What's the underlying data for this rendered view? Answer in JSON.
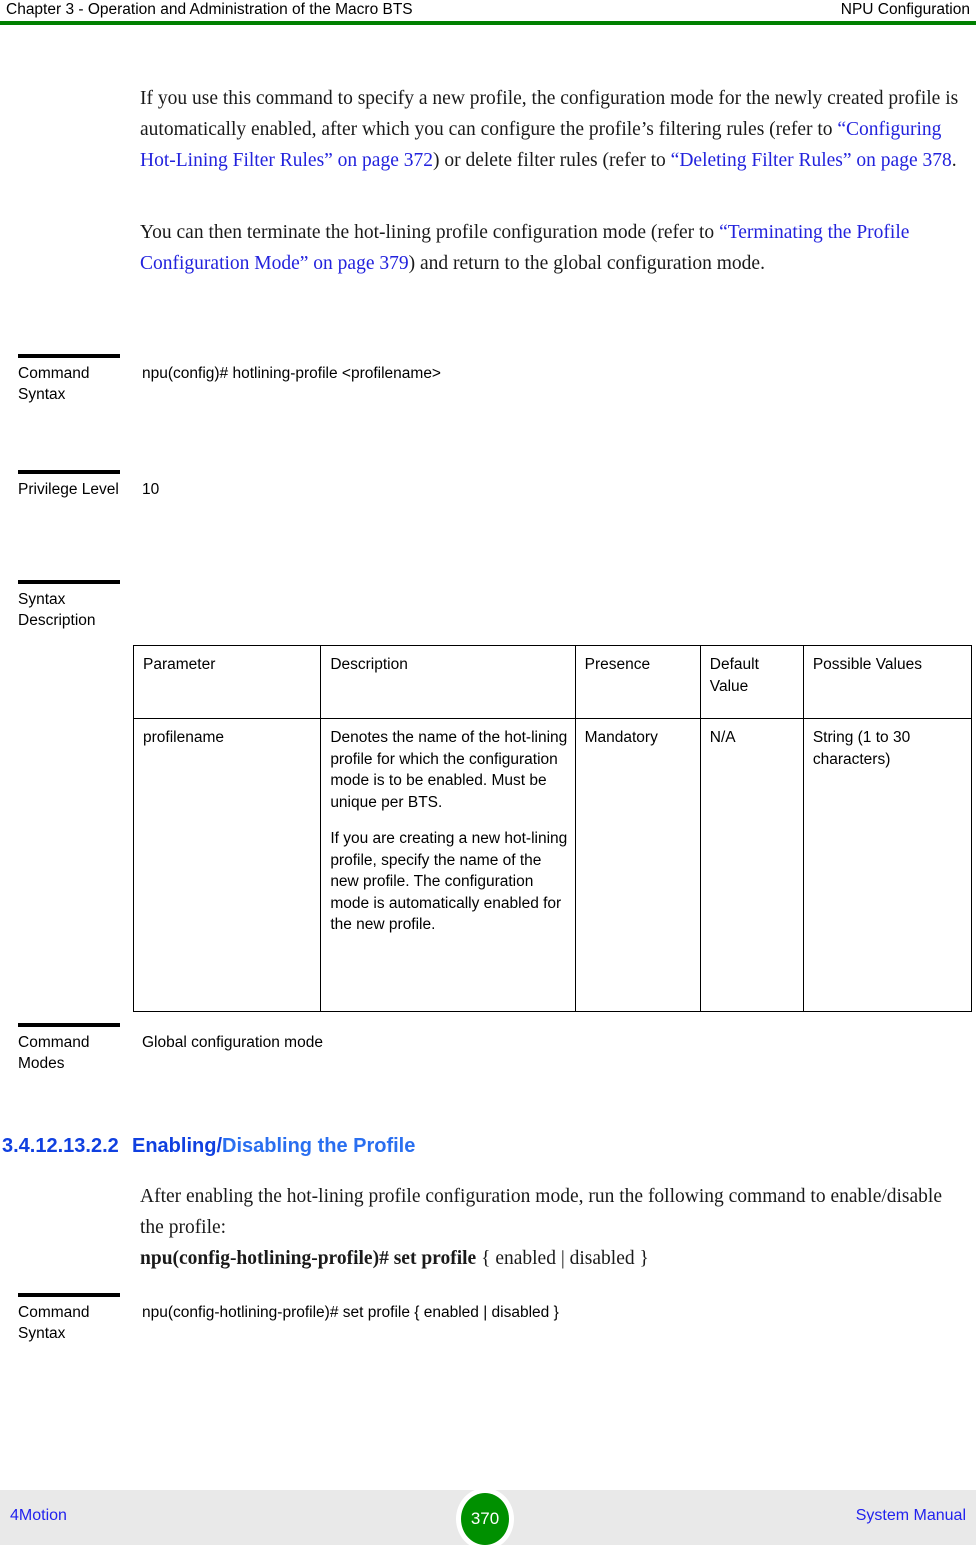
{
  "header": {
    "left": "Chapter 3 - Operation and Administration of the Macro BTS",
    "right": "NPU Configuration",
    "rule_color": "#008000"
  },
  "body": {
    "paragraph_1": {
      "text_1": "If you use this command to specify a new profile, the configuration mode for the newly created profile is automatically enabled, after which you can configure the profile’s filtering rules (refer to ",
      "link_1": "“Configuring Hot-Lining Filter Rules” on page 372",
      "text_2": ") or delete filter rules (refer to ",
      "link_2": "“Deleting Filter Rules” on page 378",
      "text_3": "."
    },
    "paragraph_2": {
      "text_1": "You can then terminate the hot-lining profile configuration mode (refer to ",
      "link_1": "“Terminating the Profile Configuration Mode” on page 379",
      "text_2": ") and return to the global configuration mode."
    },
    "paragraph_3": {
      "text_1": "After enabling the hot-lining profile configuration mode, run the following command to enable/disable the profile:",
      "command": "npu(config-hotlining-profile)# set profile",
      "command_args": "{ enabled | disabled }"
    }
  },
  "blocks": {
    "command_syntax_1": {
      "label": "Command Syntax",
      "value": "npu(config)# hotlining-profile <profilename>"
    },
    "privilege_level": {
      "label": "Privilege Level",
      "value": "10"
    },
    "syntax_description": {
      "label": "Syntax Description"
    },
    "command_modes": {
      "label": "Command Modes",
      "value": "Global configuration mode"
    },
    "command_syntax_2": {
      "label": "Command Syntax",
      "value": "npu(config-hotlining-profile)#  set profile { enabled | disabled }"
    }
  },
  "param_table": {
    "columns": [
      "Parameter",
      "Description",
      "Presence",
      "Default Value",
      "Possible Values"
    ],
    "rows": [
      {
        "parameter": "profilename",
        "description_p1": "Denotes the name of the hot-lining profile for which the configuration mode is to be enabled. Must be unique per BTS.",
        "description_p2": "If you are creating a new hot-lining profile, specify the name of the new profile. The configuration mode is automatically enabled for the new profile.",
        "presence": "Mandatory",
        "default_value": "N/A",
        "possible_values": "String (1 to 30 characters)"
      }
    ]
  },
  "section": {
    "number": "3.4.12.13.2.2",
    "title_part_1": "Enabling/",
    "title_part_2": "Disabling the Profile",
    "heading_color": "#1040e0"
  },
  "footer": {
    "left": "4Motion",
    "page_number": "370",
    "right": "System Manual",
    "badge_color": "#009000",
    "background": "#e9e9e9"
  }
}
